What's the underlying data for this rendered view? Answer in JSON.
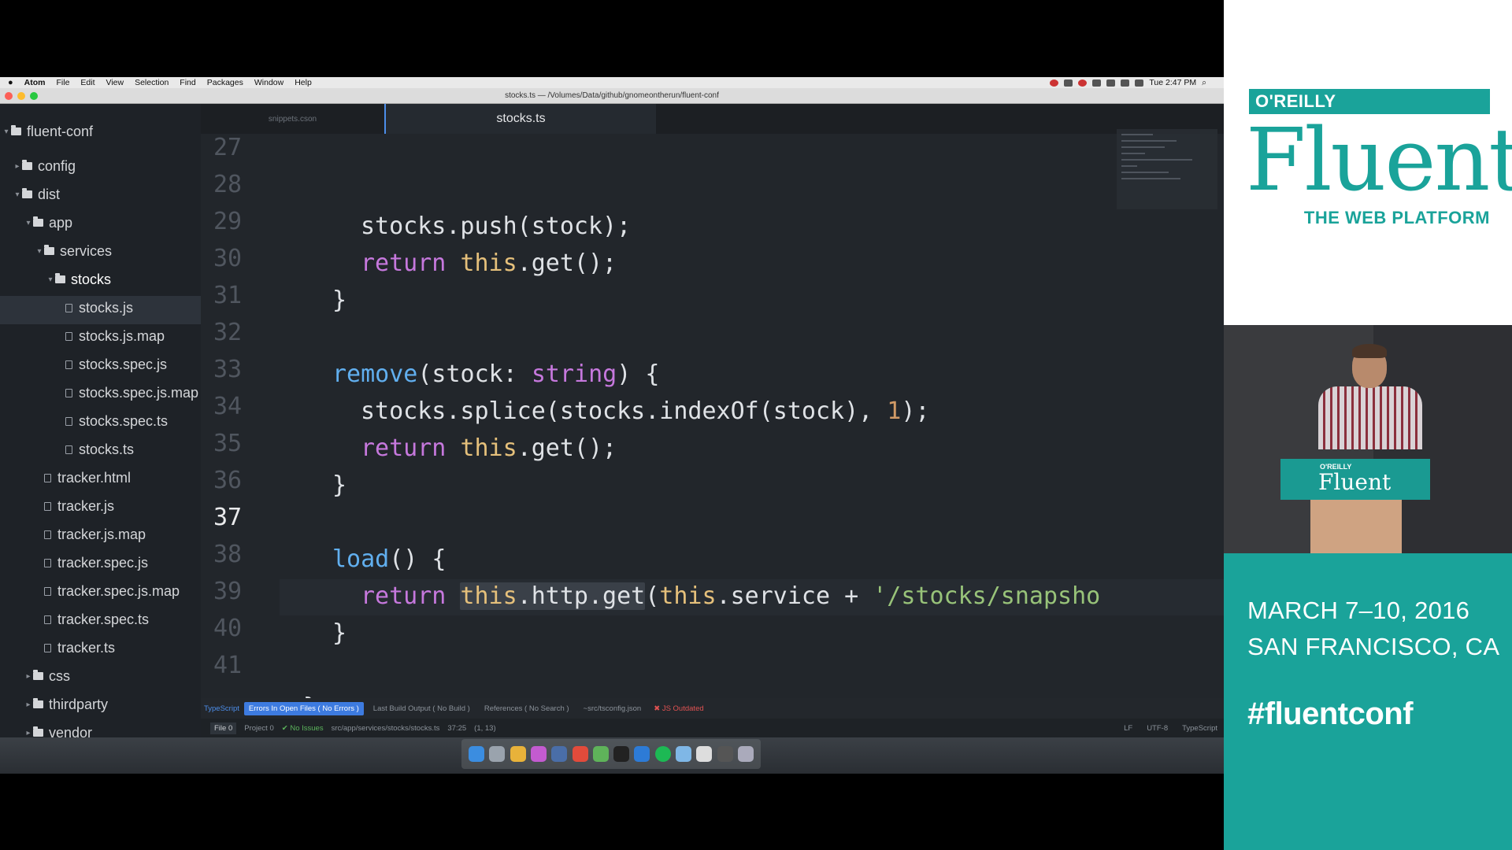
{
  "menubar": {
    "apple": "",
    "app": "Atom",
    "items": [
      "File",
      "Edit",
      "View",
      "Selection",
      "Find",
      "Packages",
      "Window",
      "Help"
    ],
    "clock": "Tue 2:47 PM"
  },
  "window": {
    "title": "stocks.ts — /Volumes/Data/github/gnomeontherun/fluent-conf"
  },
  "tree": {
    "root": "fluent-conf",
    "items": [
      "config",
      "dist",
      "app",
      "services",
      "stocks",
      "stocks.js",
      "stocks.js.map",
      "stocks.spec.js",
      "stocks.spec.js.map",
      "stocks.spec.ts",
      "stocks.ts",
      "tracker.html",
      "tracker.js",
      "tracker.js.map",
      "tracker.spec.js",
      "tracker.spec.js.map",
      "tracker.spec.ts",
      "tracker.ts",
      "css",
      "thirdparty",
      "vendor"
    ]
  },
  "tabs": [
    "snippets.cson",
    "stocks.ts"
  ],
  "lines": [
    "27",
    "28",
    "29",
    "30",
    "31",
    "32",
    "33",
    "34",
    "35",
    "36",
    "37",
    "38",
    "39",
    "40",
    "41"
  ],
  "code": {
    "l27": "stocks.push(stock);",
    "l28_kw": "return",
    "l28_this": "this",
    "l28_rest": ".get();",
    "l29": "}",
    "l31_fn": "remove",
    "l31_a": "(stock: ",
    "l31_ty": "string",
    "l31_b": ") {",
    "l32_a": "stocks.splice(stocks.indexOf(stock), ",
    "l32_num": "1",
    "l32_b": ");",
    "l33_kw": "return",
    "l33_this": "this",
    "l33_rest": ".get();",
    "l34": "}",
    "l36_fn": "load",
    "l36_rest": "() {",
    "l37_kw": "return",
    "l37_this": "this",
    "l37_hl": ".http.get",
    "l37_p": "(",
    "l37_this2": "this",
    "l37_mid": ".service + ",
    "l37_str": "'/stocks/snapsho",
    "l38": "}",
    "l40": "}"
  },
  "tsbar": {
    "ts": "TypeScript",
    "errors": "Errors In Open Files ( No Errors )",
    "build": "Last Build Output ( No Build )",
    "refs": "References ( No Search )",
    "config": "~src/tsconfig.json",
    "outdated": "✖ JS Outdated"
  },
  "status": {
    "file": "File 0",
    "project": "Project 0",
    "issues": "✔ No Issues",
    "path": "src/app/services/stocks/stocks.ts",
    "pos": "37:25",
    "sel": "(1, 13)",
    "lf": "LF",
    "enc": "UTF-8",
    "grammar": "TypeScript"
  },
  "side": {
    "oreilly": "O'REILLY",
    "fluent": "Fluent",
    "sub": "THE WEB PLATFORM",
    "date1": "MARCH 7–10, 2016",
    "date2": "SAN FRANCISCO, CA",
    "hashtag": "#fluentconf",
    "podium_or": "O'REILLY",
    "podium_fluent": "Fluent"
  },
  "colors": {
    "accent": "#1aa39a",
    "editor_bg": "#22262b",
    "keyword": "#c678dd",
    "this": "#e5c07b",
    "function": "#61afef"
  }
}
